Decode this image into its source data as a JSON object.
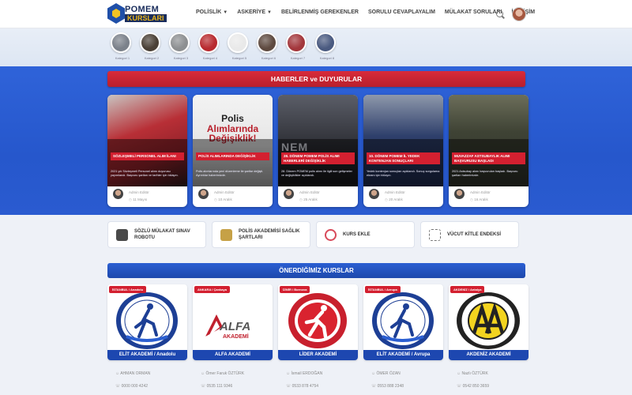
{
  "header": {
    "logo_top": "POMEM",
    "logo_bottom": "KURSLARI",
    "nav": [
      {
        "label": "POLİSLİK",
        "dropdown": true
      },
      {
        "label": "ASKERİYE",
        "dropdown": true
      },
      {
        "label": "BELİRLENMİŞ GEREKENLER",
        "dropdown": false
      },
      {
        "label": "SORULU CEVAPLAYALIM",
        "dropdown": false
      },
      {
        "label": "MÜLAKAT SORULARI",
        "dropdown": false
      },
      {
        "label": "İLETİŞİM",
        "dropdown": false
      }
    ]
  },
  "categories": [
    {
      "name": "Kategori 1",
      "color": "#7b818a"
    },
    {
      "name": "Kategori 2",
      "color": "#4a4036"
    },
    {
      "name": "Kategori 3",
      "color": "#8d8f91"
    },
    {
      "name": "Kategori 4",
      "color": "#b82a2f"
    },
    {
      "name": "Kategori 5",
      "color": "#e9e9e9"
    },
    {
      "name": "Kategori 6",
      "color": "#5e4a40"
    },
    {
      "name": "Kategori 7",
      "color": "#a3373c"
    },
    {
      "name": "Kategori 8",
      "color": "#4a5a80"
    }
  ],
  "news_section": {
    "title": "HABERLER ve DUYURULAR",
    "items": [
      {
        "tag": "SÖZLEŞMELİ PERSONEL ALIM İLANI",
        "desc": "2021 yılı Sözleşmeli Personel alımı duyurusu yayımlandı. Başvuru şartları ve tarihler için tıklayın.",
        "author": "Admin Editör",
        "date": "11 Mayıs",
        "headline": ""
      },
      {
        "tag": "POLİS ALIMLARINDA DEĞİŞİKLİK",
        "desc": "Polis alımlarında yeni düzenleme ile şartlar değişti. Ayrıntılar haberimizde.",
        "author": "Admin Editör",
        "date": "10 Aralık",
        "headline": [
          "Polis",
          "Alımlarında",
          "Değişiklik!"
        ]
      },
      {
        "tag": "28. DÖNEM POMEM POLİS ALIMI HABERLERİ DEĞİŞİKLİK",
        "desc": "28. Dönem POMEM polis alımı ile ilgili son gelişmeler ve değişiklikler açıklandı.",
        "author": "Admin Editör",
        "date": "25 Aralık",
        "headline": "NEM"
      },
      {
        "tag": "10. DÖNEM POMEM İL YEDEK KONTENJAN SONUÇLARI",
        "desc": "Yedek kontenjan sonuçları açıklandı. Sonuç sorgulama ekranı için tıklayın.",
        "author": "Admin Editör",
        "date": "20 Aralık",
        "headline": ""
      },
      {
        "tag": "MUVAZZAF ASTSUBAYLIK ALIMI BAŞVURUSU BAŞLADI",
        "desc": "2021 Astsubay alımı başvuruları başladı. Başvuru şartları haberimizde.",
        "author": "Admin Editör",
        "date": "16 Aralık",
        "headline": ""
      }
    ]
  },
  "tools": [
    {
      "label": "SÖZLÜ MÜLAKAT SINAV ROBOTU",
      "icon": "robot-icon",
      "color": "#4a4a4a"
    },
    {
      "label": "POLİS AKADEMİSİ SAĞLIK ŞARTLARI",
      "icon": "clipboard-icon",
      "color": "#c6a146"
    },
    {
      "label": "KURS EKLE",
      "icon": "plus-circle-icon",
      "color": "#d84a5a"
    },
    {
      "label": "VÜCUT KİTLE ENDEKSİ",
      "icon": "body-icon",
      "color": "#777777"
    }
  ],
  "courses_section": {
    "title": "ÖNERDİĞİMİZ KURSLAR",
    "items": [
      {
        "ribbon": "İSTANBUL / Anadolu",
        "name": "ELİT AKADEMİ / Anadolu",
        "owner": "AHMAN ORMAN",
        "phone": "0000 000 4242",
        "logo": "elit"
      },
      {
        "ribbon": "ANKARA / Çankaya",
        "name": "ALFA AKADEMİ",
        "owner": "Ömer Faruk ÖZTÜRK",
        "phone": "0535 111 9346",
        "logo": "alfa"
      },
      {
        "ribbon": "İZMİR / Bornova",
        "name": "LİDER AKADEMİ",
        "owner": "İsmail ERDOĞAN",
        "phone": "0533 878 4754",
        "logo": "lider"
      },
      {
        "ribbon": "İSTANBUL / Avrupa",
        "name": "ELİT AKADEMİ / Avrupa",
        "owner": "ÖMER ÖZAN",
        "phone": "0553 888 2348",
        "logo": "elit"
      },
      {
        "ribbon": "AKDENİZ / Antalya",
        "name": "AKDENİZ AKADEMİ",
        "owner": "Nazlı ÖZTÜRK",
        "phone": "0542 850 3659",
        "logo": "akdeniz"
      }
    ]
  }
}
